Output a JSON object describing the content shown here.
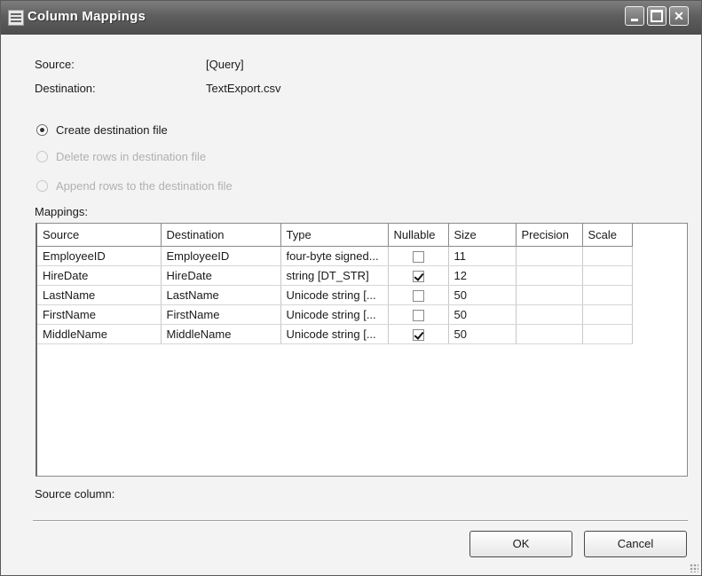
{
  "window": {
    "title": "Column Mappings"
  },
  "info": {
    "source_label": "Source:",
    "source_value": "[Query]",
    "destination_label": "Destination:",
    "destination_value": "TextExport.csv"
  },
  "options": [
    {
      "label": "Create destination file",
      "checked": true,
      "enabled": true
    },
    {
      "label": "Delete rows in destination file",
      "checked": false,
      "enabled": false
    },
    {
      "label": "Append rows to the destination file",
      "checked": false,
      "enabled": false
    }
  ],
  "mappings_label": "Mappings:",
  "grid": {
    "columns": [
      "Source",
      "Destination",
      "Type",
      "Nullable",
      "Size",
      "Precision",
      "Scale"
    ],
    "rows": [
      {
        "source": "EmployeeID",
        "destination": "EmployeeID",
        "type": "four-byte signed...",
        "nullable": false,
        "size": "11",
        "precision": "",
        "scale": ""
      },
      {
        "source": "HireDate",
        "destination": "HireDate",
        "type": "string [DT_STR]",
        "nullable": true,
        "size": "12",
        "precision": "",
        "scale": ""
      },
      {
        "source": "LastName",
        "destination": "LastName",
        "type": "Unicode string [...",
        "nullable": false,
        "size": "50",
        "precision": "",
        "scale": ""
      },
      {
        "source": "FirstName",
        "destination": "FirstName",
        "type": "Unicode string [...",
        "nullable": false,
        "size": "50",
        "precision": "",
        "scale": ""
      },
      {
        "source": "MiddleName",
        "destination": "MiddleName",
        "type": "Unicode string [...",
        "nullable": true,
        "size": "50",
        "precision": "",
        "scale": ""
      }
    ]
  },
  "source_column_label": "Source column:",
  "buttons": {
    "ok": "OK",
    "cancel": "Cancel"
  }
}
